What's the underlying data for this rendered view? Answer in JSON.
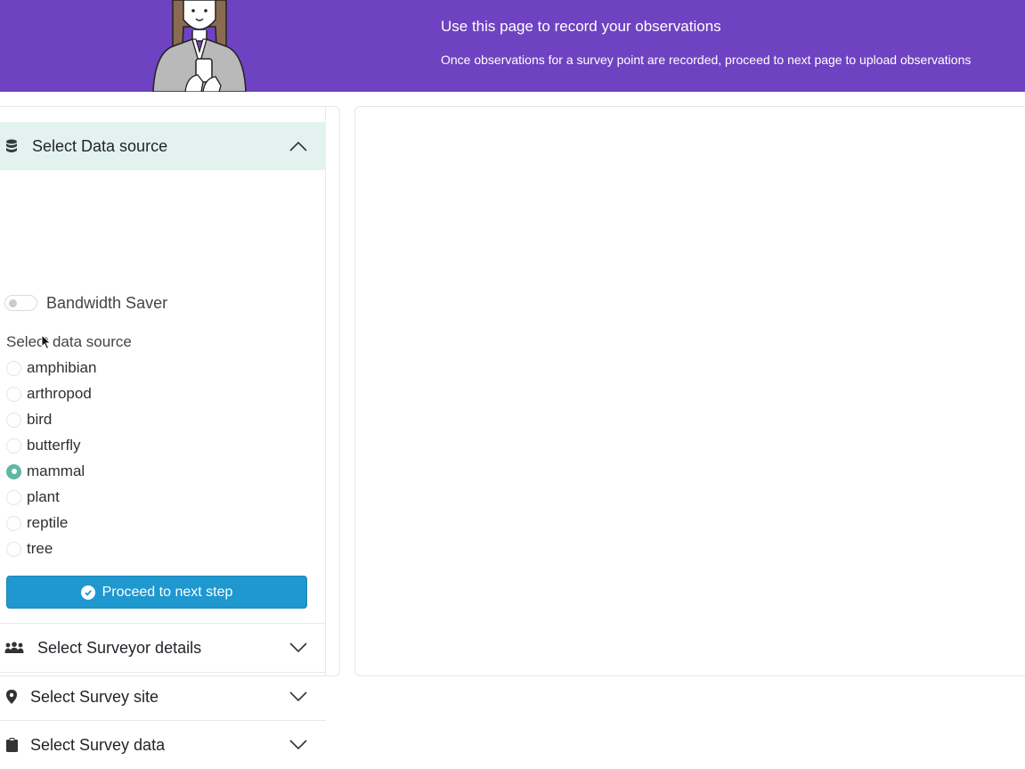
{
  "header": {
    "title": "Use this page to record your observations",
    "subtitle": "Once observations for a survey point are recorded, proceed to next page to upload observations",
    "background_color": "#6f42c1"
  },
  "sidebar": {
    "data_source": {
      "heading": "Select Data source",
      "icon": "database-icon",
      "expanded": true,
      "bandwidth_saver": {
        "label": "Bandwidth Saver",
        "on": false
      },
      "group_label": "Select data source",
      "options": [
        "amphibian",
        "arthropod",
        "bird",
        "butterfly",
        "mammal",
        "plant",
        "reptile",
        "tree"
      ],
      "selected": "mammal",
      "proceed_label": "Proceed to next step",
      "proceed_color": "#1e98cf"
    },
    "surveyor": {
      "heading": "Select Surveyor details",
      "icon": "people-icon",
      "expanded": false
    },
    "site": {
      "heading": "Select Survey site",
      "icon": "map-pin-icon",
      "expanded": false
    },
    "survey_data": {
      "heading": "Select Survey data",
      "icon": "clipboard-icon",
      "expanded": false
    }
  },
  "accent_color": "#5fb8a5"
}
